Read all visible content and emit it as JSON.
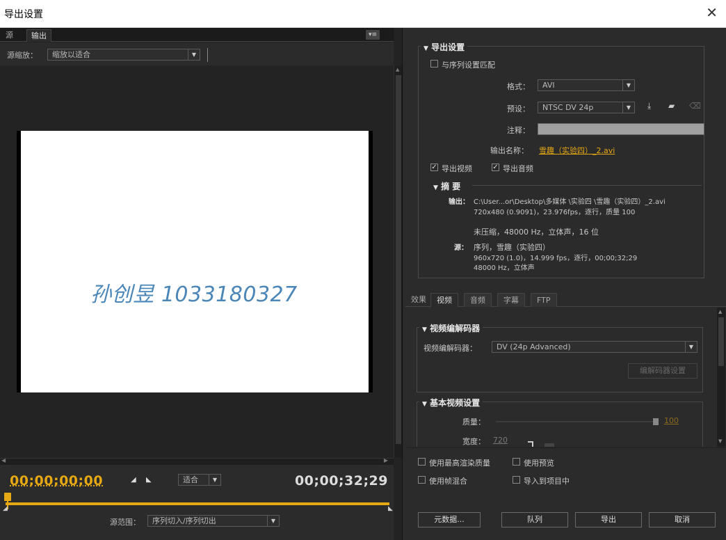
{
  "window": {
    "title": "导出设置",
    "close_glyph": "✕"
  },
  "left": {
    "tabs": [
      "源",
      "输出"
    ],
    "panel_menu_glyph": "▾≡",
    "scale_label": "源缩放：",
    "scale_value": "缩放以适合",
    "preview_watermark": "孙创昱 1033180327",
    "timecode_start": "00;00;00;00",
    "timecode_end": "00;00;32;29",
    "mark_in_glyph": "◢",
    "mark_out_glyph": "◣",
    "fit_value": "适合",
    "range_label": "源范围：",
    "range_value": "序列切入/序列切出"
  },
  "export_settings": {
    "header": "导出设置",
    "match_sequence": "与序列设置匹配",
    "format_label": "格式：",
    "format_value": "AVI",
    "preset_label": "预设：",
    "preset_value": "NTSC DV 24p",
    "comment_label": "注释：",
    "output_name_label": "输出名称：",
    "output_name_value": "雪趣（实验四）_2.avi",
    "export_video": "导出视频",
    "export_audio": "导出音频",
    "summary_header": "摘 要",
    "output_key": "输出：",
    "output_line1": "C:\\User...or\\Desktop\\多媒体 \\实验四 \\雪趣（实验四）_2.avi",
    "output_line2": "720x480 (0.9091)，23.976fps，逐行，质量 100",
    "output_line3": "未压缩，48000 Hz，立体声，16 位",
    "source_key": "源：",
    "source_line1": "序列，雪趣（实验四）",
    "source_line2": "960x720 (1.0)，14.999 fps，逐行，00;00;32;29",
    "source_line3": "48000 Hz，立体声"
  },
  "tabs": [
    "效果",
    "视频",
    "音频",
    "字幕",
    "FTP"
  ],
  "video": {
    "codec_header": "视频编解码器",
    "codec_label": "视频编解码器：",
    "codec_value": "DV (24p Advanced)",
    "codec_settings_button": "编解码器设置",
    "basic_header": "基本视频设置",
    "quality_label": "质量：",
    "quality_value": "100",
    "quality_level": 1.0,
    "width_label": "宽度：",
    "width_value": "720"
  },
  "bottom": {
    "max_render_quality": "使用最高渲染质量",
    "use_preview": "使用预览",
    "frame_blending": "使用帧混合",
    "import_to_project": "导入到项目中",
    "metadata_button": "元数据...",
    "queue_button": "队列",
    "export_button": "导出",
    "cancel_button": "取消"
  },
  "icons": {
    "save_preset": "download-icon",
    "import_preset": "folder-icon",
    "delete_preset": "trash-icon"
  }
}
